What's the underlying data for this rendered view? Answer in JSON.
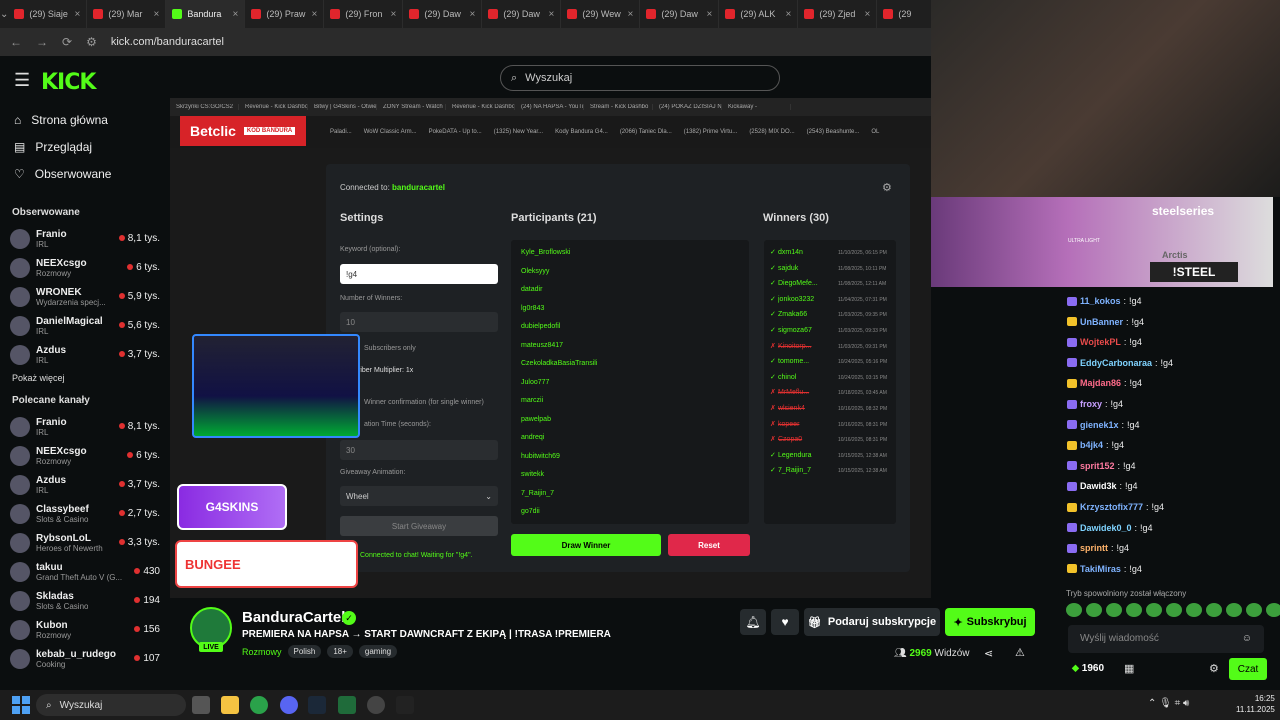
{
  "browser": {
    "tabs": [
      "(29) Siaje",
      "(29) Mar",
      "Bandura",
      "(29) Praw",
      "(29) Fron",
      "(29) Daw",
      "(29) Daw",
      "(29) Wew",
      "(29) Daw",
      "(29) ALK",
      "(29) Zjed",
      "(29"
    ],
    "url": "kick.com/banduracartel"
  },
  "kick": {
    "logo": "KICK",
    "search_placeholder": "Wyszukaj"
  },
  "sidebar": {
    "nav": [
      {
        "label": "Strona główna",
        "icon": "home-icon"
      },
      {
        "label": "Przeglądaj",
        "icon": "browse-icon"
      },
      {
        "label": "Obserwowane",
        "icon": "heart-icon"
      }
    ],
    "followed_title": "Obserwowane",
    "followed": [
      {
        "name": "Franio",
        "cat": "IRL",
        "viewers": "8,1 tys."
      },
      {
        "name": "NEEXcsgo",
        "cat": "Rozmowy",
        "viewers": "6 tys."
      },
      {
        "name": "WRONEK",
        "cat": "Wydarzenia specj...",
        "viewers": "5,9 tys."
      },
      {
        "name": "DanielMagical",
        "cat": "IRL",
        "viewers": "5,6 tys."
      },
      {
        "name": "Azdus",
        "cat": "IRL",
        "viewers": "3,7 tys."
      }
    ],
    "show_more": "Pokaż więcej",
    "recommended_title": "Polecane kanały",
    "recommended": [
      {
        "name": "Franio",
        "cat": "IRL",
        "viewers": "8,1 tys."
      },
      {
        "name": "NEEXcsgo",
        "cat": "Rozmowy",
        "viewers": "6 tys."
      },
      {
        "name": "Azdus",
        "cat": "IRL",
        "viewers": "3,7 tys."
      },
      {
        "name": "Classybeef",
        "cat": "Slots & Casino",
        "viewers": "2,7 tys."
      },
      {
        "name": "RybsonLoL",
        "cat": "Heroes of Newerth",
        "viewers": "3,3 tys."
      },
      {
        "name": "takuu",
        "cat": "Grand Theft Auto V (G...",
        "viewers": "430"
      },
      {
        "name": "Skladas",
        "cat": "Slots & Casino",
        "viewers": "194"
      },
      {
        "name": "Kubon",
        "cat": "Rozmowy",
        "viewers": "156"
      },
      {
        "name": "kebab_u_rudego",
        "cat": "Cooking",
        "viewers": "107"
      }
    ]
  },
  "stream_screen": {
    "inner_tabs": [
      "Skrzynki CS:GO/CS2",
      "Revenue - Kick Dashbo",
      "Bitwy | G4Skins - Otwie",
      "ZONY Stream - Watch",
      "Revenue - Kick Dashbo",
      "(24) NA HAPSA - YouTu",
      "Stream - Kick Dashbo",
      "(24) POKAŻ DZISIAJ N",
      "Kickaway -"
    ],
    "bookmarks": [
      "Paladi...",
      "WoW Classic Arm...",
      "PokeDATA - Up to...",
      "(1325) New Year...",
      "Kody Bandura G4...",
      "(2066) Taniec Dla...",
      "(1382) Prime Virtu...",
      "(2528) MIX DO...",
      "(2543) Beashunte...",
      "OL"
    ],
    "betclic": "Betclic",
    "betclic_code": "KOD BANDURA",
    "connected_prefix": "Connected to:",
    "connected_user": "banduracartel",
    "settings_title": "Settings",
    "keyword_label": "Keyword (optional):",
    "keyword_value": "!g4",
    "winners_label": "Number of Winners:",
    "winners_value": "10",
    "subs_only": "Subscribers only",
    "multiplier": "riber Multiplier: 1x",
    "confirm": "Winner confirmation (for single winner)",
    "duration": "ation Time (seconds):",
    "duration_value": "30",
    "anim_label": "Giveaway Animation:",
    "anim_value": "Wheel",
    "start": "Start Giveaway",
    "status": "Connected to chat! Waiting for \"!g4\".",
    "participants_title": "Participants (21)",
    "participants": [
      "Kyle_Broflowski",
      "Oleksyyy",
      "datadir",
      "lg0r843",
      "dubielpedofil",
      "mateusz8417",
      "CzekoladkaBasiaTransili",
      "Juloo777",
      "marczii",
      "pawelpab",
      "andreqi",
      "hubitwitch69",
      "switekk",
      "7_Raijin_7",
      "go7dii"
    ],
    "winners_title": "Winners (30)",
    "winners": [
      {
        "name": "dxm14n",
        "date": "11/10/2025, 06:15 PM",
        "x": false
      },
      {
        "name": "sajduk",
        "date": "11/08/2025, 10:11 PM",
        "x": false
      },
      {
        "name": "DiegoMefe...",
        "date": "11/08/2025, 12:11 AM",
        "x": false
      },
      {
        "name": "jonkoo3232",
        "date": "11/04/2025, 07:31 PM",
        "x": false
      },
      {
        "name": "Zmaka66",
        "date": "11/03/2025, 09:35 PM",
        "x": false
      },
      {
        "name": "sigmoza67",
        "date": "11/03/2025, 09:33 PM",
        "x": false
      },
      {
        "name": "Kinoitorp...",
        "date": "11/03/2025, 09:31 PM",
        "x": true
      },
      {
        "name": "tomome...",
        "date": "10/24/2025, 05:16 PM",
        "x": false
      },
      {
        "name": "chinol",
        "date": "10/24/2025, 03:15 PM",
        "x": false
      },
      {
        "name": "MrMeflu...",
        "date": "10/18/2025, 03:45 AM",
        "x": true
      },
      {
        "name": "wlsienk4",
        "date": "10/16/2025, 08:32 PM",
        "x": true
      },
      {
        "name": "kopeer",
        "date": "10/16/2025, 08:31 PM",
        "x": true
      },
      {
        "name": "Czopa0",
        "date": "10/16/2025, 08:31 PM",
        "x": true
      },
      {
        "name": "Legendura",
        "date": "10/15/2025, 12:38 AM",
        "x": false
      },
      {
        "name": "7_Raijin_7",
        "date": "10/15/2025, 12:38 AM",
        "x": false
      }
    ],
    "draw": "Draw Winner",
    "reset": "Reset",
    "g4skins": "G4SKINS",
    "bungee": "BUNGEE"
  },
  "stream_info": {
    "name": "BanduraCartel",
    "live": "LIVE",
    "title": "PREMIERA NA HAPSA → START DAWNCRAFT Z EKIPĄ | !TRASA !PREMIERA",
    "category": "Rozmowy",
    "tags": [
      "Polish",
      "18+",
      "gaming"
    ],
    "gift_label": "Podaruj subskrypcje",
    "subscribe_label": "Subskrybuj",
    "viewers": "2969",
    "viewers_label": "Widzów"
  },
  "ads": {
    "steelseries": "steelseries",
    "steel_cmd": "!STEEL",
    "ultra": "ULTRA LIGHT",
    "arctis": "Arctis"
  },
  "chat": {
    "messages": [
      {
        "user": "11_kokos",
        "color": "#7fb3ff",
        "text": "!g4"
      },
      {
        "user": "UnBanner",
        "color": "#7fb3ff",
        "text": "!g4"
      },
      {
        "user": "WojtekPL",
        "color": "#e84b4b",
        "text": "!g4"
      },
      {
        "user": "EddyCarbonaraa",
        "color": "#7fd3ff",
        "text": "!g4"
      },
      {
        "user": "Majdan86",
        "color": "#ff6b8a",
        "text": "!g4"
      },
      {
        "user": "froxy",
        "color": "#c7a0ff",
        "text": "!g4"
      },
      {
        "user": "gienek1x",
        "color": "#7fb3ff",
        "text": "!g4"
      },
      {
        "user": "b4jk4",
        "color": "#7fb3ff",
        "text": "!g4"
      },
      {
        "user": "sprit152",
        "color": "#ff7aa0",
        "text": "!g4"
      },
      {
        "user": "Dawid3k",
        "color": "#ffffff",
        "text": "!g4"
      },
      {
        "user": "Krzysztofix777",
        "color": "#7fb3ff",
        "text": "!g4"
      },
      {
        "user": "Dawidek0_0",
        "color": "#7fd3ff",
        "text": "!g4"
      },
      {
        "user": "sprintt",
        "color": "#ffb36b",
        "text": "!g4"
      },
      {
        "user": "TakiMiras",
        "color": "#7fb3ff",
        "text": "!g4"
      }
    ],
    "slow_mode": "Tryb spowolniony został włączony",
    "input_placeholder": "Wyślij wiadomość",
    "points": "1960",
    "send": "Czat"
  },
  "taskbar": {
    "search": "Wyszukaj",
    "time": "16:25",
    "date": "11.11.2025"
  }
}
